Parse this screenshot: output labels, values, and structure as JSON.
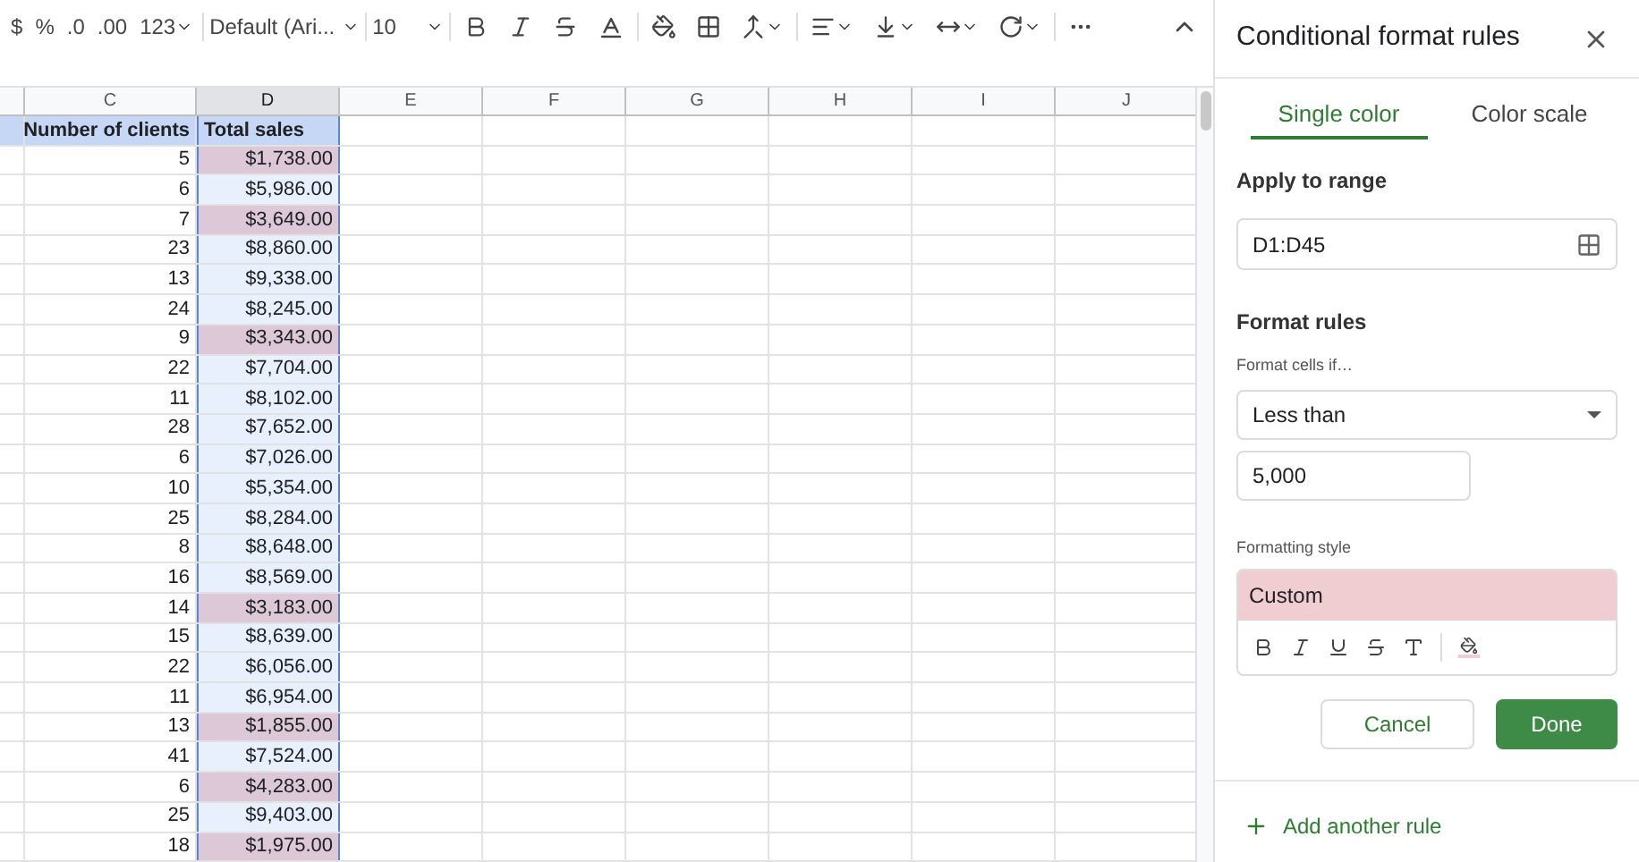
{
  "toolbar": {
    "texts": [
      "$",
      "%",
      ".0",
      ".00",
      "123"
    ],
    "font": "Default (Ari...",
    "font_size": "10"
  },
  "columns": [
    {
      "label": "C",
      "selected": false
    },
    {
      "label": "D",
      "selected": true
    },
    {
      "label": "E",
      "selected": false
    },
    {
      "label": "F",
      "selected": false
    },
    {
      "label": "G",
      "selected": false
    },
    {
      "label": "H",
      "selected": false
    },
    {
      "label": "I",
      "selected": false
    },
    {
      "label": "J",
      "selected": false
    }
  ],
  "header": [
    "Number of clients",
    "Total sales"
  ],
  "rows": [
    {
      "clients": "5",
      "sales": "$1,738.00",
      "highlighted": true
    },
    {
      "clients": "6",
      "sales": "$5,986.00",
      "highlighted": false
    },
    {
      "clients": "7",
      "sales": "$3,649.00",
      "highlighted": true
    },
    {
      "clients": "23",
      "sales": "$8,860.00",
      "highlighted": false
    },
    {
      "clients": "13",
      "sales": "$9,338.00",
      "highlighted": false
    },
    {
      "clients": "24",
      "sales": "$8,245.00",
      "highlighted": false
    },
    {
      "clients": "9",
      "sales": "$3,343.00",
      "highlighted": true
    },
    {
      "clients": "22",
      "sales": "$7,704.00",
      "highlighted": false
    },
    {
      "clients": "11",
      "sales": "$8,102.00",
      "highlighted": false
    },
    {
      "clients": "28",
      "sales": "$7,652.00",
      "highlighted": false
    },
    {
      "clients": "6",
      "sales": "$7,026.00",
      "highlighted": false
    },
    {
      "clients": "10",
      "sales": "$5,354.00",
      "highlighted": false
    },
    {
      "clients": "25",
      "sales": "$8,284.00",
      "highlighted": false
    },
    {
      "clients": "8",
      "sales": "$8,648.00",
      "highlighted": false
    },
    {
      "clients": "16",
      "sales": "$8,569.00",
      "highlighted": false
    },
    {
      "clients": "14",
      "sales": "$3,183.00",
      "highlighted": true
    },
    {
      "clients": "15",
      "sales": "$8,639.00",
      "highlighted": false
    },
    {
      "clients": "22",
      "sales": "$6,056.00",
      "highlighted": false
    },
    {
      "clients": "11",
      "sales": "$6,954.00",
      "highlighted": false
    },
    {
      "clients": "13",
      "sales": "$1,855.00",
      "highlighted": true
    },
    {
      "clients": "41",
      "sales": "$7,524.00",
      "highlighted": false
    },
    {
      "clients": "6",
      "sales": "$4,283.00",
      "highlighted": true
    },
    {
      "clients": "25",
      "sales": "$9,403.00",
      "highlighted": false
    },
    {
      "clients": "18",
      "sales": "$1,975.00",
      "highlighted": true
    }
  ],
  "panel": {
    "title": "Conditional format rules",
    "tabs": [
      {
        "label": "Single color",
        "selected": true
      },
      {
        "label": "Color scale",
        "selected": false
      }
    ],
    "apply_to_range": {
      "label": "Apply to range",
      "value": "D1:D45"
    },
    "format_rules": {
      "heading": "Format rules",
      "condition_label": "Format cells if…",
      "condition": "Less than",
      "value": "5,000"
    },
    "formatting_style": {
      "label": "Formatting style",
      "preview": "Custom",
      "color": "#f0cdd0"
    },
    "buttons": [
      "Cancel",
      "Done"
    ],
    "add_rule": "Add another rule"
  }
}
